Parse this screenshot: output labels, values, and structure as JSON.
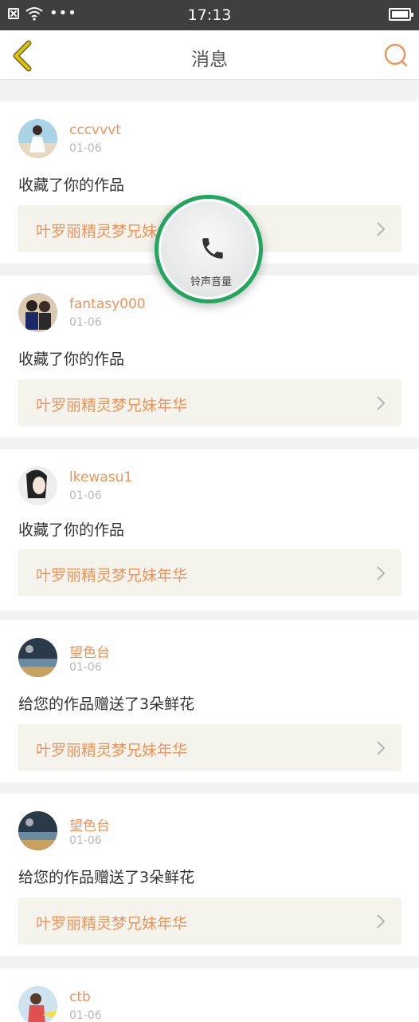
{
  "status_bar": {
    "time": "17:13",
    "dots": "•••"
  },
  "nav": {
    "title": "消息"
  },
  "overlay": {
    "label": "铃声音量"
  },
  "notifications": [
    {
      "username": "cccvvvt",
      "date": "01-06",
      "action": "收藏了你的作品",
      "work_title": "叶罗丽精灵梦兄妹年华"
    },
    {
      "username": "fantasy000",
      "date": "01-06",
      "action": "收藏了你的作品",
      "work_title": "叶罗丽精灵梦兄妹年华"
    },
    {
      "username": "lkewasu1",
      "date": "01-06",
      "action": "收藏了你的作品",
      "work_title": "叶罗丽精灵梦兄妹年华"
    },
    {
      "username": "望色台",
      "date": "01-06",
      "action": "给您的作品赠送了3朵鲜花",
      "work_title": "叶罗丽精灵梦兄妹年华"
    },
    {
      "username": "望色台",
      "date": "01-06",
      "action": "给您的作品赠送了3朵鲜花",
      "work_title": "叶罗丽精灵梦兄妹年华"
    },
    {
      "username": "ctb",
      "date": "01-06",
      "action": "",
      "work_title": ""
    }
  ],
  "colors": {
    "accent": "#f0935a",
    "back_icon": "#e0c400",
    "overlay_ring": "#22a55e"
  }
}
